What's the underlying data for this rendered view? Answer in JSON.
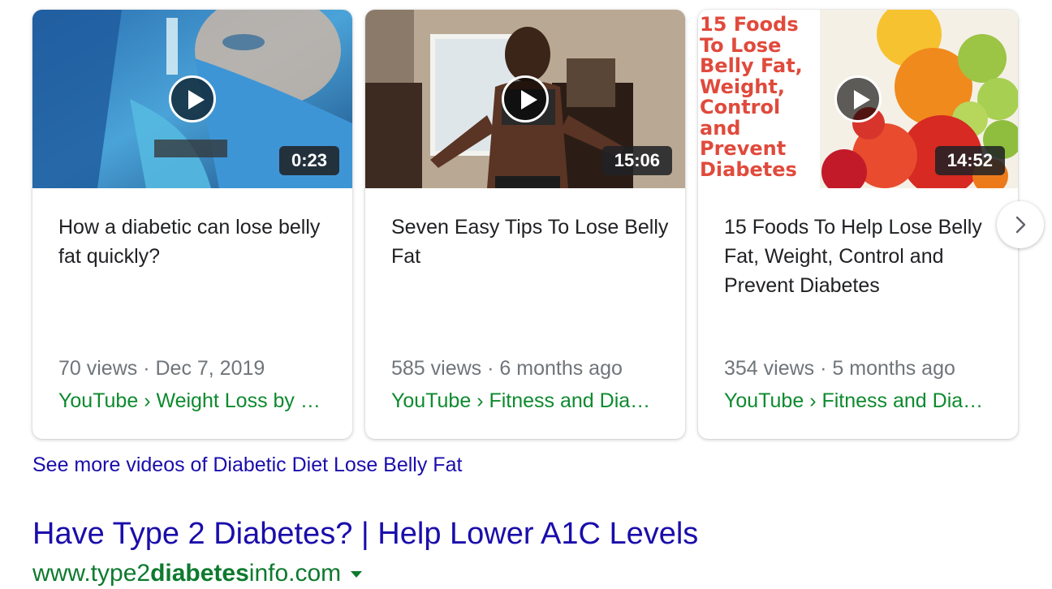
{
  "videos": [
    {
      "title": "How a diabetic can lose belly fat quickly?",
      "duration": "0:23",
      "views": "70 views",
      "date": "Dec 7, 2019",
      "source": "YouTube › Weight Loss by …"
    },
    {
      "title": "Seven Easy Tips To Lose Belly Fat",
      "duration": "15:06",
      "views": "585 views",
      "date": "6 months ago",
      "source": "YouTube › Fitness and Dia…"
    },
    {
      "title": "15 Foods To Help Lose Belly Fat, Weight, Control and Prevent Diabetes",
      "duration": "14:52",
      "views": "354 views",
      "date": "5 months ago",
      "source": "YouTube › Fitness and Dia…",
      "thumbnail_text": "15 Foods\nTo Lose\nBelly Fat,\nWeight,\nControl\nand\nPrevent\nDiabetes"
    }
  ],
  "separator": " · ",
  "next_icon": "chevron-right-icon",
  "see_more_label": "See more videos of Diabetic Diet Lose Belly Fat",
  "ad": {
    "title": "Have Type 2 Diabetes? | Help Lower A1C Levels",
    "url_prefix": "www.type2",
    "url_bold": "diabetes",
    "url_suffix": "info.com"
  },
  "colors": {
    "link": "#1a0dab",
    "source_green": "#0d8a2e",
    "meta_gray": "#70757a"
  }
}
